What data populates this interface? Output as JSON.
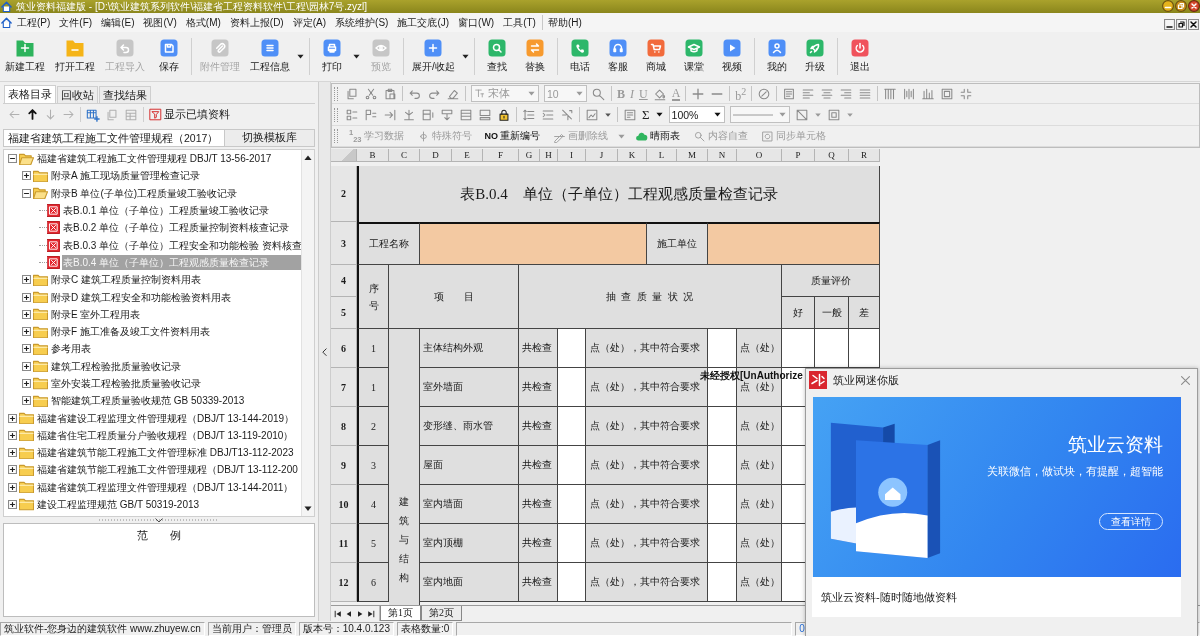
{
  "window": {
    "title": "筑业资料福建版 - [D:\\筑业建筑系列软件\\福建省工程资料软件\\工程\\园林7号.zyzl]"
  },
  "menu": [
    [
      "工程(P)",
      "文件(F)",
      "编辑(E)",
      "视图(V)",
      "格式(M)",
      "资料上报(D)",
      "评定(A)",
      "系统维护(S)",
      "施工交底(J)",
      "窗口(W)",
      "工具(T)"
    ],
    [
      "帮助(H)"
    ]
  ],
  "toolbar": [
    [
      {
        "label": "新建工程",
        "disabled": false,
        "dropdown": false
      },
      {
        "label": "打开工程",
        "disabled": false,
        "dropdown": false
      },
      {
        "label": "工程导入",
        "disabled": true,
        "dropdown": false
      },
      {
        "label": "保存",
        "disabled": false,
        "dropdown": false
      }
    ],
    [
      {
        "label": "附件管理",
        "disabled": true,
        "dropdown": false
      },
      {
        "label": "工程信息",
        "disabled": false,
        "dropdown": true
      }
    ],
    [
      {
        "label": "打印",
        "disabled": false,
        "dropdown": true
      },
      {
        "label": "预览",
        "disabled": true,
        "dropdown": false
      }
    ],
    [
      {
        "label": "展开/收起",
        "disabled": false,
        "dropdown": true
      }
    ],
    [
      {
        "label": "查找",
        "disabled": false,
        "dropdown": false
      },
      {
        "label": "替换",
        "disabled": false,
        "dropdown": false
      }
    ],
    [
      {
        "label": "电话",
        "disabled": false,
        "dropdown": false
      },
      {
        "label": "客服",
        "disabled": false,
        "dropdown": false
      },
      {
        "label": "商城",
        "disabled": false,
        "dropdown": false
      },
      {
        "label": "课堂",
        "disabled": false,
        "dropdown": false
      },
      {
        "label": "视频",
        "disabled": false,
        "dropdown": false
      }
    ],
    [
      {
        "label": "我的",
        "disabled": false,
        "dropdown": false
      },
      {
        "label": "升级",
        "disabled": false,
        "dropdown": false
      }
    ],
    [
      {
        "label": "退出",
        "disabled": false,
        "dropdown": false
      }
    ]
  ],
  "left_panel": {
    "tabs": [
      {
        "label": "表格目录",
        "selected": true
      },
      {
        "label": "回收站",
        "selected": false
      },
      {
        "label": "查找结果",
        "selected": false
      }
    ],
    "nav_buttons": [
      {
        "disabled": true
      },
      {
        "disabled": false
      },
      {
        "disabled": true
      },
      {
        "disabled": true
      }
    ],
    "tool_buttons": [
      {
        "disabled": false
      },
      {
        "disabled": true
      },
      {
        "disabled": true
      }
    ],
    "filter_button": "显示已填资料",
    "library": "福建省建筑工程施工文件管理规程（2017）",
    "switch_button": "切换模板库",
    "tree": [
      {
        "kind": "folder",
        "label": "福建省建筑工程施工文件管理规程 DBJ/T 13-56-2017",
        "expanded": true,
        "selected": false,
        "children": [
          {
            "kind": "folder",
            "label": "附录A 施工现场质量管理检查记录",
            "expanded": false,
            "selected": false
          },
          {
            "kind": "folder",
            "label": "附录B 单位(子单位)工程质量竣工验收记录",
            "expanded": true,
            "selected": false,
            "children": [
              {
                "kind": "form",
                "label": "表B.0.1 单位（子单位）工程质量竣工验收记录",
                "expanded": false,
                "selected": false
              },
              {
                "kind": "form",
                "label": "表B.0.2 单位（子单位）工程质量控制资料核查记录",
                "expanded": false,
                "selected": false
              },
              {
                "kind": "form",
                "label": "表B.0.3 单位（子单位）工程安全和功能检验 资料核查",
                "expanded": false,
                "selected": false
              },
              {
                "kind": "form",
                "label": "表B.0.4 单位（子单位）工程观感质量检查记录",
                "expanded": false,
                "selected": true
              }
            ]
          },
          {
            "kind": "folder",
            "label": "附录C 建筑工程质量控制资料用表",
            "expanded": false,
            "selected": false
          },
          {
            "kind": "folder",
            "label": "附录D 建筑工程安全和功能检验资料用表",
            "expanded": false,
            "selected": false
          },
          {
            "kind": "folder",
            "label": "附录E 室外工程用表",
            "expanded": false,
            "selected": false
          },
          {
            "kind": "folder",
            "label": "附录F 施工准备及竣工文件资料用表",
            "expanded": false,
            "selected": false
          },
          {
            "kind": "folder",
            "label": "参考用表",
            "expanded": false,
            "selected": false
          },
          {
            "kind": "folder",
            "label": "建筑工程检验批质量验收记录",
            "expanded": false,
            "selected": false
          },
          {
            "kind": "folder",
            "label": "室外安装工程检验批质量验收记录",
            "expanded": false,
            "selected": false
          },
          {
            "kind": "folder",
            "label": "智能建筑工程质量验收规范 GB 50339-2013",
            "expanded": false,
            "selected": false
          }
        ]
      },
      {
        "kind": "folder",
        "label": "福建省建设工程监理文件管理规程（DBJ/T 13-144-2019）",
        "expanded": false,
        "selected": false
      },
      {
        "kind": "folder",
        "label": "福建省住宅工程质量分户验收规程（DBJ/T 13-119-2010）",
        "expanded": false,
        "selected": false
      },
      {
        "kind": "folder",
        "label": "福建省建筑节能工程施工文件管理标准 DBJ/T13-112-2023",
        "expanded": false,
        "selected": false
      },
      {
        "kind": "folder",
        "label": "福建省建筑节能工程施工文件管理规程（DBJ/T 13-112-200",
        "expanded": false,
        "selected": false
      },
      {
        "kind": "folder",
        "label": "福建省建筑工程监理文件管理规程（DBJ/T 13-144-2011）",
        "expanded": false,
        "selected": false
      },
      {
        "kind": "folder",
        "label": "建设工程监理规范 GB/T 50319-2013",
        "expanded": false,
        "selected": false
      }
    ],
    "legend_title": "范　　例"
  },
  "format_bar": {
    "font": {
      "value": "宋体",
      "disabled": true
    },
    "font_size": {
      "value": "10",
      "disabled": true
    },
    "text_styles": [
      {
        "label": "B",
        "disabled": true
      },
      {
        "label": "I",
        "disabled": true
      },
      {
        "label": "U",
        "disabled": true
      }
    ],
    "font_color": {
      "label": "A",
      "disabled": true
    },
    "superscript": {
      "label": "b$^{2}$",
      "disabled": true
    },
    "sum": {
      "label": "Σ",
      "disabled": false
    },
    "zoom": {
      "value": "100%",
      "disabled": false
    },
    "commands": [
      {
        "symbol": "$^{1}$$_{23}$",
        "label": "学习数据",
        "disabled": true,
        "dropdown": false
      },
      {
        "label": "特殊符号",
        "disabled": true,
        "dropdown": false
      },
      {
        "symbol": "NO",
        "label": "重新编号",
        "disabled": false,
        "dropdown": false
      },
      {
        "label": "画删除线",
        "disabled": true,
        "dropdown": true
      },
      {
        "label": "晴雨表",
        "disabled": false,
        "dropdown": false
      },
      {
        "label": "内容自查",
        "disabled": true,
        "dropdown": false
      },
      {
        "label": "同步单元格",
        "disabled": true,
        "dropdown": false
      }
    ]
  },
  "sheet": {
    "columns": [
      "B",
      "C",
      "D",
      "E",
      "F",
      "G",
      "H",
      "I",
      "J",
      "K",
      "L",
      "M",
      "N",
      "O",
      "P",
      "Q",
      "R"
    ],
    "row_numbers": [
      "2",
      "3",
      "4",
      "5",
      "6",
      "7",
      "8",
      "9",
      "10",
      "11",
      "12"
    ],
    "title": "表B.0.4　单位（子单位）工程观感质量检查记录",
    "project_label": "工程名称",
    "contractor_label": "施工单位",
    "no_header": "序号",
    "item_header": "项　　目",
    "check_header": "抽 查 质 量 状 况",
    "rating_header": "质量评价",
    "grades": [
      "好",
      "一般",
      "差"
    ],
    "group": "建筑与结构",
    "rows": [
      {
        "no": "1",
        "item": "主体结构外观",
        "total_label": "共检查",
        "match_label": "点（处），其中符合要求",
        "unit_label": "点（处）"
      },
      {
        "no": "1",
        "item": "室外墙面",
        "total_label": "共检查",
        "match_label": "点（处），其中符合要求",
        "unit_label": "点（处）"
      },
      {
        "no": "2",
        "item": "变形缝、雨水管",
        "total_label": "共检查",
        "match_label": "点（处），其中符合要求",
        "unit_label": "点（处）"
      },
      {
        "no": "3",
        "item": "屋面",
        "total_label": "共检查",
        "match_label": "点（处），其中符合要求",
        "unit_label": "点（处）"
      },
      {
        "no": "4",
        "item": "室内墙面",
        "total_label": "共检查",
        "match_label": "点（处），其中符合要求",
        "unit_label": "点（处）"
      },
      {
        "no": "5",
        "item": "室内顶棚",
        "total_label": "共检查",
        "match_label": "点（处），其中符合要求",
        "unit_label": "点（处）"
      },
      {
        "no": "6",
        "item": "室内地面",
        "total_label": "共检查",
        "match_label": "点（处），其中符合要求",
        "unit_label": "点（处）"
      }
    ],
    "notice": "未经授权[UnAuthorize",
    "tabs": [
      {
        "label": "第1页",
        "selected": true
      },
      {
        "label": "第2页",
        "selected": false
      }
    ]
  },
  "status_bar": {
    "segments": [
      "筑业软件-您身边的建筑软件 www.zhuyew.cn",
      "当前用户：管理员",
      "版本号：10.4.0.123",
      "表格数量:0"
    ],
    "progress": "0"
  },
  "popup": {
    "title": "筑业网迷你版",
    "heading": "筑业云资料",
    "tagline": "关联微信，做试块，有提醒，超智能",
    "button": "查看详情",
    "caption": "筑业云资料-随时随地做资料"
  }
}
